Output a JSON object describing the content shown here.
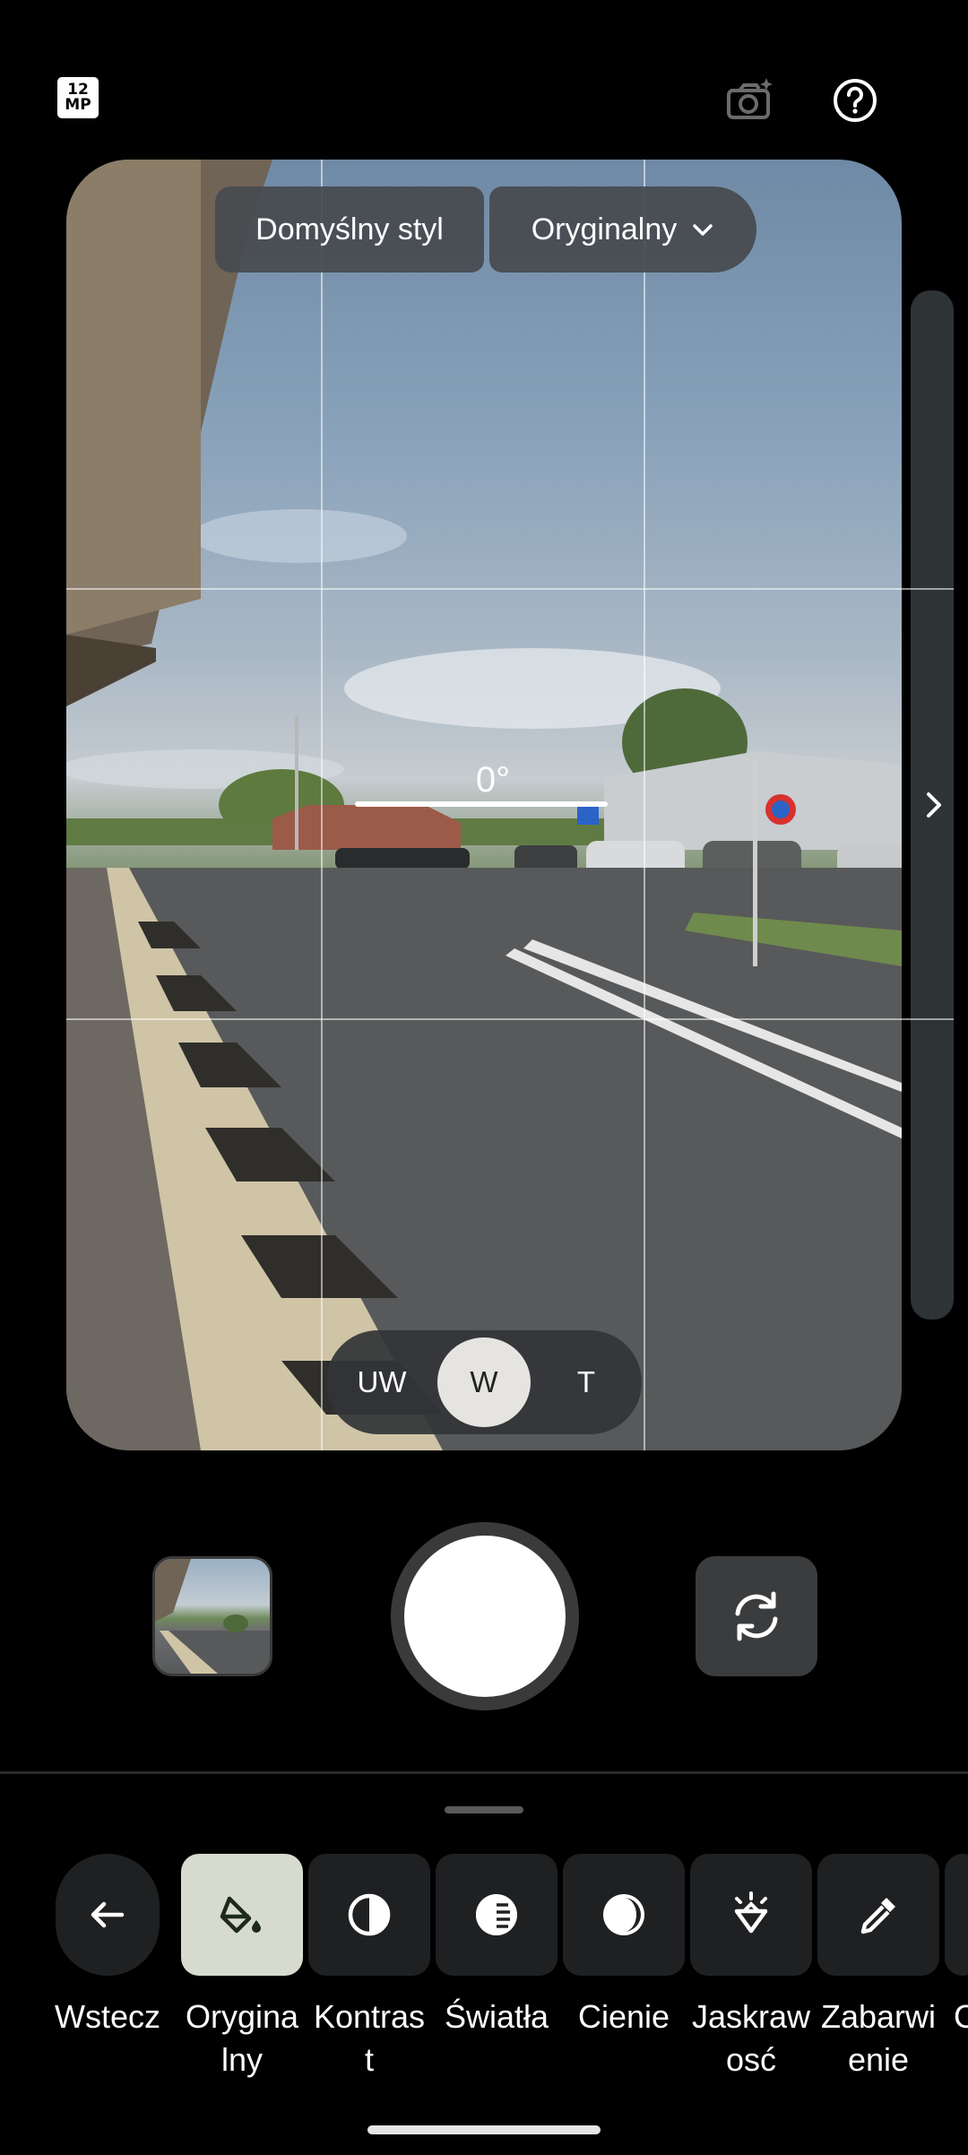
{
  "top_bar": {
    "resolution_badge": "12\nMP",
    "icons": [
      "camera-sparkle-icon",
      "help-icon"
    ]
  },
  "viewfinder": {
    "style_button": "Domyślny styl",
    "filter_dropdown": "Oryginalny",
    "level_readout": "0°",
    "lenses": [
      "UW",
      "W",
      "T"
    ],
    "active_lens": "W"
  },
  "controls": {
    "icons": [
      "gallery-thumbnail",
      "shutter-button",
      "flip-camera-icon"
    ]
  },
  "tools": [
    {
      "label": "Wstecz",
      "icon": "arrow-back-icon"
    },
    {
      "label": "Orygina\nlny",
      "icon": "paint-bucket-icon",
      "selected": true
    },
    {
      "label": "Kontras\nt",
      "icon": "contrast-icon"
    },
    {
      "label": "Światła",
      "icon": "highlights-icon"
    },
    {
      "label": "Cienie",
      "icon": "shadows-icon"
    },
    {
      "label": "Jaskraw\nosć",
      "icon": "vibrance-icon"
    },
    {
      "label": "Zabarwi\nenie",
      "icon": "tint-dropper-icon"
    }
  ],
  "colors": {
    "selected_tool_bg": "#d7dbcf",
    "tool_bg": "#1f2022",
    "pill_bg": "#464a4e"
  }
}
